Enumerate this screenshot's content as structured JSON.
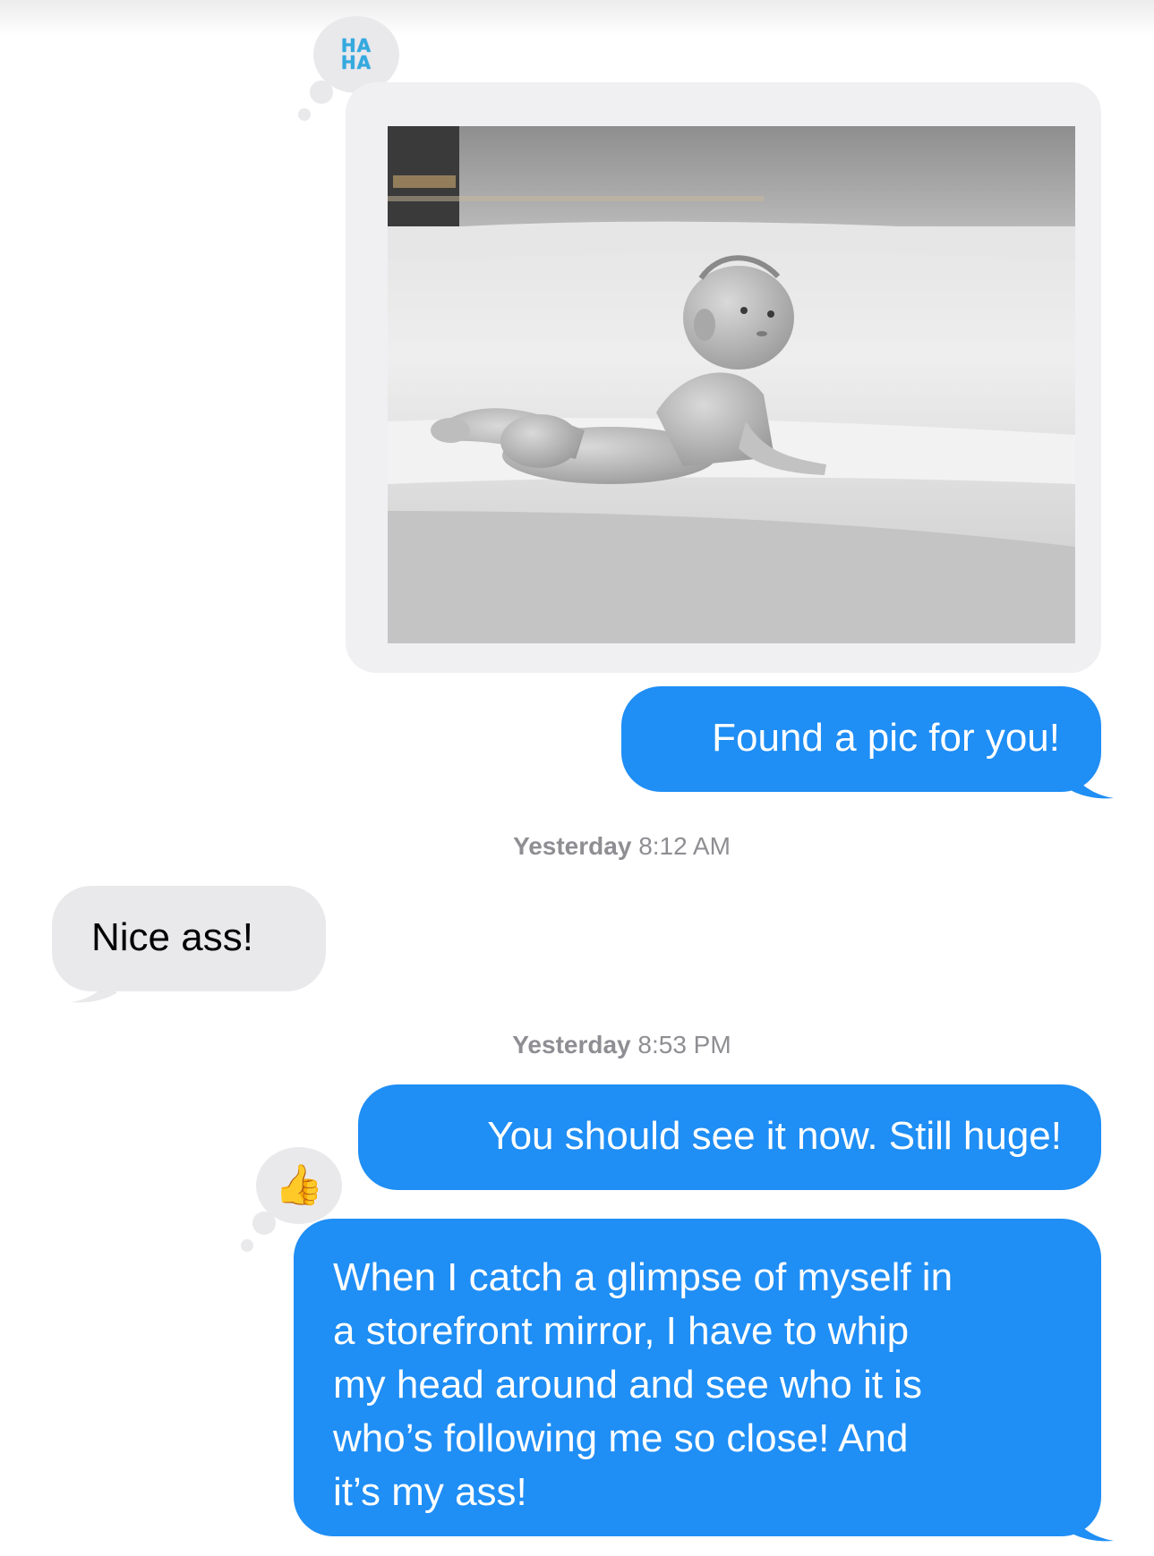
{
  "conversation": {
    "messages": [
      {
        "id": "m1",
        "direction": "sent",
        "type": "photo",
        "reaction": "HA HA",
        "reaction_lines": [
          "HA",
          "HA"
        ]
      },
      {
        "id": "m2",
        "direction": "sent",
        "text": "Found a pic for you!"
      },
      {
        "id": "ts1",
        "type": "timestamp",
        "day": "Yesterday",
        "time": "8:12 AM"
      },
      {
        "id": "m3",
        "direction": "received",
        "text": "Nice ass!"
      },
      {
        "id": "ts2",
        "type": "timestamp",
        "day": "Yesterday",
        "time": "8:53 PM"
      },
      {
        "id": "m4",
        "direction": "sent",
        "text": "You should see it now. Still huge!"
      },
      {
        "id": "m5",
        "direction": "sent",
        "reaction": "thumbs-up",
        "reaction_glyph": "👍",
        "text_lines": [
          "When I catch a glimpse of myself in",
          "a storefront mirror, I have to whip",
          "my head around and see who it is",
          "who’s following me so close! And",
          "it’s my ass!"
        ]
      }
    ]
  },
  "colors": {
    "sent_bubble": "#1f8ef5",
    "received_bubble": "#e9e9eb",
    "timestamp": "#8e8e93",
    "haha_reaction": "#34aadc"
  },
  "icons": {
    "haha_reaction": "haha-icon",
    "thumbs_up_reaction": "thumbs-up-icon"
  }
}
